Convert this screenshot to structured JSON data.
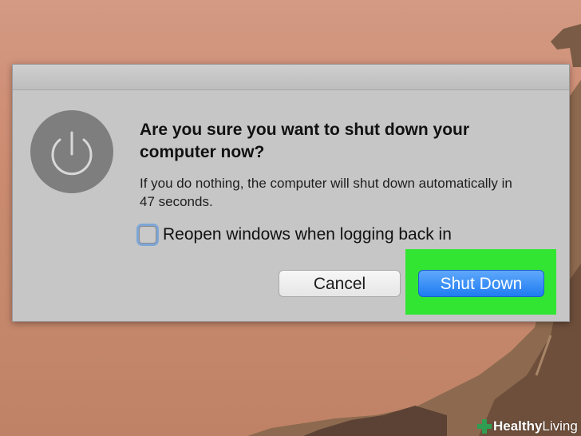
{
  "dialog": {
    "headline": "Are you sure you want to shut down your computer now?",
    "body": "If you do nothing, the computer will shut down automatically in 47 seconds.",
    "checkbox_label": "Reopen windows when logging back in",
    "checkbox_checked": false,
    "cancel_label": "Cancel",
    "confirm_label": "Shut Down",
    "icon": "power-icon"
  },
  "colors": {
    "highlight": "#33e533",
    "primary_button": "#1f7cf1",
    "dialog_background": "#c6c6c6"
  },
  "watermark": {
    "brand_bold": "Healthy",
    "brand_regular": " Living"
  }
}
